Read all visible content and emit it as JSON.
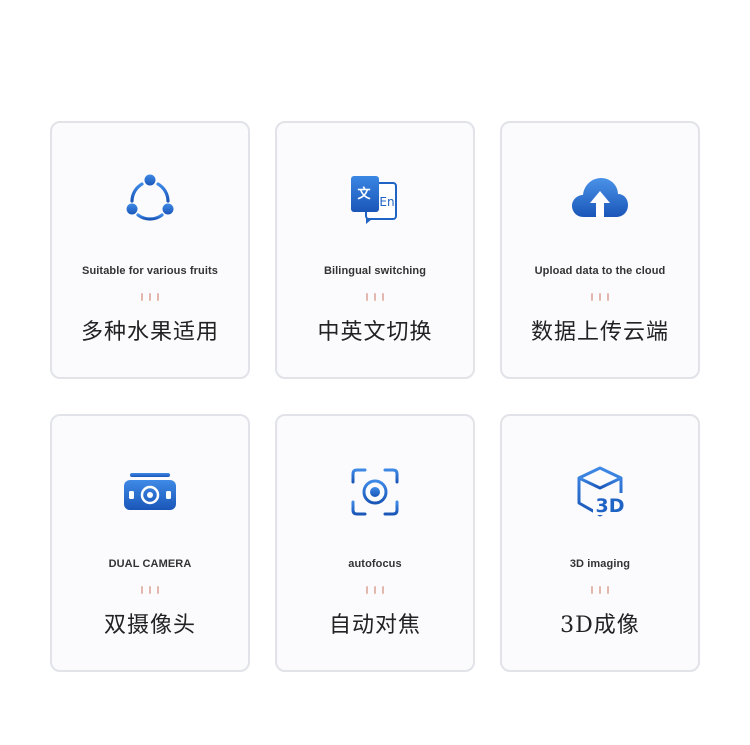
{
  "features": [
    {
      "icon": "share-nodes-icon",
      "en": "Suitable for various fruits",
      "zh": "多种水果适用"
    },
    {
      "icon": "translate-icon",
      "en": "Bilingual switching",
      "zh": "中英文切换",
      "icon_text": {
        "zh": "文",
        "en": "En"
      }
    },
    {
      "icon": "cloud-upload-icon",
      "en": "Upload data to the cloud",
      "zh": "数据上传云端"
    },
    {
      "icon": "dual-camera-icon",
      "en": "DUAL CAMERA",
      "zh": "双摄像头"
    },
    {
      "icon": "autofocus-icon",
      "en": "autofocus",
      "zh": "自动对焦"
    },
    {
      "icon": "3d-cube-icon",
      "en": "3D imaging",
      "zh": "3D成像",
      "icon_text": {
        "label": "3D"
      }
    }
  ],
  "colors": {
    "icon_blue": "#1f63c4",
    "icon_blue_light": "#4a90e2",
    "card_border": "#e1e3e9",
    "tick": "#e3b7ad"
  }
}
